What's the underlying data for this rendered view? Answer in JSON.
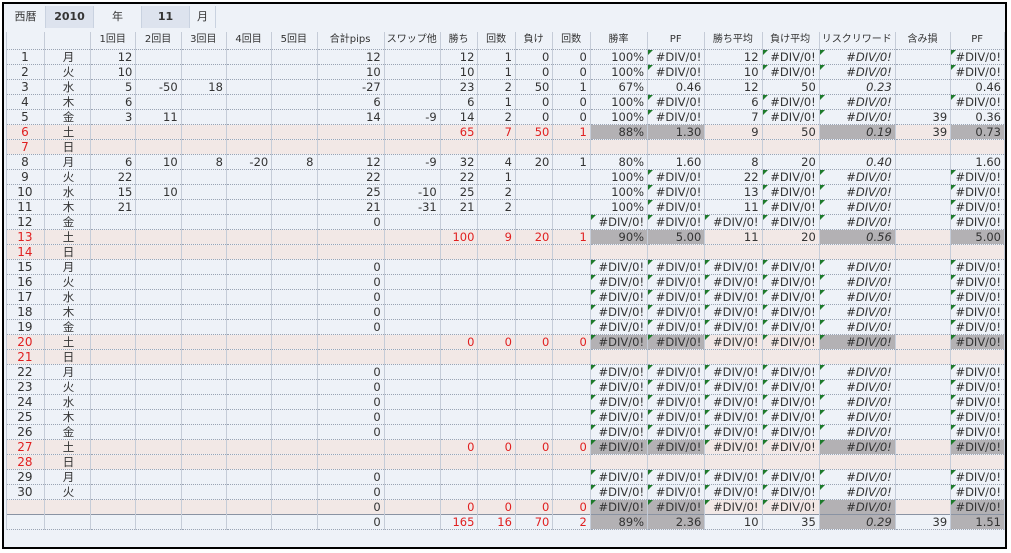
{
  "top": {
    "era_label": "西暦",
    "year_value": "2010",
    "year_label": "年",
    "month_value": "11",
    "month_label": "月"
  },
  "headers": [
    "",
    "",
    "1回目",
    "2回目",
    "3回目",
    "4回目",
    "5回目",
    "合計pips",
    "スワップ他",
    "勝ち",
    "回数",
    "負け",
    "回数",
    "勝率",
    "PF",
    "勝ち平均",
    "負け平均",
    "リスクリワード",
    "含み損",
    "PF"
  ],
  "colors": {
    "weekend_bg": "#f2e8e6",
    "red_text": "#e02020",
    "gray_cell": "#b3b1b4",
    "sheet_bg": "#eef2f8"
  },
  "rows": [
    {
      "t": "d",
      "c": [
        "1",
        "月",
        "12",
        "",
        "",
        "",
        "",
        "12",
        "",
        "12",
        "1",
        "0",
        "0",
        "100%",
        "#DIV/0!",
        "12",
        "#DIV/0!",
        "#DIV/0!",
        "",
        "#DIV/0!"
      ]
    },
    {
      "t": "d",
      "c": [
        "2",
        "火",
        "10",
        "",
        "",
        "",
        "",
        "10",
        "",
        "10",
        "1",
        "0",
        "0",
        "100%",
        "#DIV/0!",
        "10",
        "#DIV/0!",
        "#DIV/0!",
        "",
        "#DIV/0!"
      ]
    },
    {
      "t": "d",
      "c": [
        "3",
        "水",
        "5",
        "-50",
        "18",
        "",
        "",
        "-27",
        "",
        "23",
        "2",
        "50",
        "1",
        "67%",
        "0.46",
        "12",
        "50",
        "0.23",
        "",
        "0.46"
      ]
    },
    {
      "t": "d",
      "c": [
        "4",
        "木",
        "6",
        "",
        "",
        "",
        "",
        "6",
        "",
        "6",
        "1",
        "0",
        "0",
        "100%",
        "#DIV/0!",
        "6",
        "#DIV/0!",
        "#DIV/0!",
        "",
        "#DIV/0!"
      ]
    },
    {
      "t": "d",
      "c": [
        "5",
        "金",
        "3",
        "11",
        "",
        "",
        "",
        "14",
        "-9",
        "14",
        "2",
        "0",
        "0",
        "100%",
        "#DIV/0!",
        "7",
        "#DIV/0!",
        "#DIV/0!",
        "39",
        "0.36"
      ]
    },
    {
      "t": "w",
      "c": [
        "6",
        "土",
        "",
        "",
        "",
        "",
        "",
        "",
        "",
        "65",
        "7",
        "50",
        "1",
        "88%",
        "1.30",
        "9",
        "50",
        "0.19",
        "39",
        "0.73"
      ]
    },
    {
      "t": "s",
      "c": [
        "7",
        "日",
        "",
        "",
        "",
        "",
        "",
        "",
        "",
        "",
        "",
        "",
        "",
        "",
        "",
        "",
        "",
        "",
        "",
        ""
      ]
    },
    {
      "t": "d",
      "c": [
        "8",
        "月",
        "6",
        "10",
        "8",
        "-20",
        "8",
        "12",
        "-9",
        "32",
        "4",
        "20",
        "1",
        "80%",
        "1.60",
        "8",
        "20",
        "0.40",
        "",
        "1.60"
      ]
    },
    {
      "t": "d",
      "c": [
        "9",
        "火",
        "22",
        "",
        "",
        "",
        "",
        "22",
        "",
        "22",
        "1",
        "",
        "",
        "100%",
        "#DIV/0!",
        "22",
        "#DIV/0!",
        "#DIV/0!",
        "",
        "#DIV/0!"
      ]
    },
    {
      "t": "d",
      "c": [
        "10",
        "水",
        "15",
        "10",
        "",
        "",
        "",
        "25",
        "-10",
        "25",
        "2",
        "",
        "",
        "100%",
        "#DIV/0!",
        "13",
        "#DIV/0!",
        "#DIV/0!",
        "",
        "#DIV/0!"
      ]
    },
    {
      "t": "d",
      "c": [
        "11",
        "木",
        "21",
        "",
        "",
        "",
        "",
        "21",
        "-31",
        "21",
        "2",
        "",
        "",
        "100%",
        "#DIV/0!",
        "11",
        "#DIV/0!",
        "#DIV/0!",
        "",
        "#DIV/0!"
      ]
    },
    {
      "t": "d",
      "c": [
        "12",
        "金",
        "",
        "",
        "",
        "",
        "",
        "0",
        "",
        "",
        "",
        "",
        "",
        "#DIV/0!",
        "#DIV/0!",
        "#DIV/0!",
        "#DIV/0!",
        "#DIV/0!",
        "",
        "#DIV/0!"
      ]
    },
    {
      "t": "w",
      "c": [
        "13",
        "土",
        "",
        "",
        "",
        "",
        "",
        "",
        "",
        "100",
        "9",
        "20",
        "1",
        "90%",
        "5.00",
        "11",
        "20",
        "0.56",
        "",
        "5.00"
      ]
    },
    {
      "t": "s",
      "c": [
        "14",
        "日",
        "",
        "",
        "",
        "",
        "",
        "",
        "",
        "",
        "",
        "",
        "",
        "",
        "",
        "",
        "",
        "",
        "",
        ""
      ]
    },
    {
      "t": "d",
      "c": [
        "15",
        "月",
        "",
        "",
        "",
        "",
        "",
        "0",
        "",
        "",
        "",
        "",
        "",
        "#DIV/0!",
        "#DIV/0!",
        "#DIV/0!",
        "#DIV/0!",
        "#DIV/0!",
        "",
        "#DIV/0!"
      ]
    },
    {
      "t": "d",
      "c": [
        "16",
        "火",
        "",
        "",
        "",
        "",
        "",
        "0",
        "",
        "",
        "",
        "",
        "",
        "#DIV/0!",
        "#DIV/0!",
        "#DIV/0!",
        "#DIV/0!",
        "#DIV/0!",
        "",
        "#DIV/0!"
      ]
    },
    {
      "t": "d",
      "c": [
        "17",
        "水",
        "",
        "",
        "",
        "",
        "",
        "0",
        "",
        "",
        "",
        "",
        "",
        "#DIV/0!",
        "#DIV/0!",
        "#DIV/0!",
        "#DIV/0!",
        "#DIV/0!",
        "",
        "#DIV/0!"
      ]
    },
    {
      "t": "d",
      "c": [
        "18",
        "木",
        "",
        "",
        "",
        "",
        "",
        "0",
        "",
        "",
        "",
        "",
        "",
        "#DIV/0!",
        "#DIV/0!",
        "#DIV/0!",
        "#DIV/0!",
        "#DIV/0!",
        "",
        "#DIV/0!"
      ]
    },
    {
      "t": "d",
      "c": [
        "19",
        "金",
        "",
        "",
        "",
        "",
        "",
        "0",
        "",
        "",
        "",
        "",
        "",
        "#DIV/0!",
        "#DIV/0!",
        "#DIV/0!",
        "#DIV/0!",
        "#DIV/0!",
        "",
        "#DIV/0!"
      ]
    },
    {
      "t": "w",
      "c": [
        "20",
        "土",
        "",
        "",
        "",
        "",
        "",
        "",
        "",
        "0",
        "0",
        "0",
        "0",
        "#DIV/0!",
        "#DIV/0!",
        "#DIV/0!",
        "#DIV/0!",
        "#DIV/0!",
        "",
        "#DIV/0!"
      ]
    },
    {
      "t": "s",
      "c": [
        "21",
        "日",
        "",
        "",
        "",
        "",
        "",
        "",
        "",
        "",
        "",
        "",
        "",
        "",
        "",
        "",
        "",
        "",
        "",
        ""
      ]
    },
    {
      "t": "d",
      "c": [
        "22",
        "月",
        "",
        "",
        "",
        "",
        "",
        "0",
        "",
        "",
        "",
        "",
        "",
        "#DIV/0!",
        "#DIV/0!",
        "#DIV/0!",
        "#DIV/0!",
        "#DIV/0!",
        "",
        "#DIV/0!"
      ]
    },
    {
      "t": "d",
      "c": [
        "23",
        "火",
        "",
        "",
        "",
        "",
        "",
        "0",
        "",
        "",
        "",
        "",
        "",
        "#DIV/0!",
        "#DIV/0!",
        "#DIV/0!",
        "#DIV/0!",
        "#DIV/0!",
        "",
        "#DIV/0!"
      ]
    },
    {
      "t": "d",
      "c": [
        "24",
        "水",
        "",
        "",
        "",
        "",
        "",
        "0",
        "",
        "",
        "",
        "",
        "",
        "#DIV/0!",
        "#DIV/0!",
        "#DIV/0!",
        "#DIV/0!",
        "#DIV/0!",
        "",
        "#DIV/0!"
      ]
    },
    {
      "t": "d",
      "c": [
        "25",
        "木",
        "",
        "",
        "",
        "",
        "",
        "0",
        "",
        "",
        "",
        "",
        "",
        "#DIV/0!",
        "#DIV/0!",
        "#DIV/0!",
        "#DIV/0!",
        "#DIV/0!",
        "",
        "#DIV/0!"
      ]
    },
    {
      "t": "d",
      "c": [
        "26",
        "金",
        "",
        "",
        "",
        "",
        "",
        "0",
        "",
        "",
        "",
        "",
        "",
        "#DIV/0!",
        "#DIV/0!",
        "#DIV/0!",
        "#DIV/0!",
        "#DIV/0!",
        "",
        "#DIV/0!"
      ]
    },
    {
      "t": "w",
      "c": [
        "27",
        "土",
        "",
        "",
        "",
        "",
        "",
        "",
        "",
        "0",
        "0",
        "0",
        "0",
        "#DIV/0!",
        "#DIV/0!",
        "#DIV/0!",
        "#DIV/0!",
        "#DIV/0!",
        "",
        "#DIV/0!"
      ]
    },
    {
      "t": "s",
      "c": [
        "28",
        "日",
        "",
        "",
        "",
        "",
        "",
        "",
        "",
        "",
        "",
        "",
        "",
        "",
        "",
        "",
        "",
        "",
        "",
        ""
      ]
    },
    {
      "t": "d",
      "c": [
        "29",
        "月",
        "",
        "",
        "",
        "",
        "",
        "0",
        "",
        "",
        "",
        "",
        "",
        "#DIV/0!",
        "#DIV/0!",
        "#DIV/0!",
        "#DIV/0!",
        "#DIV/0!",
        "",
        "#DIV/0!"
      ]
    },
    {
      "t": "d",
      "c": [
        "30",
        "火",
        "",
        "",
        "",
        "",
        "",
        "0",
        "",
        "",
        "",
        "",
        "",
        "#DIV/0!",
        "#DIV/0!",
        "#DIV/0!",
        "#DIV/0!",
        "#DIV/0!",
        "",
        "#DIV/0!"
      ]
    },
    {
      "t": "w",
      "c": [
        "",
        "",
        "",
        "",
        "",
        "",
        "",
        "0",
        "",
        "0",
        "0",
        "0",
        "0",
        "#DIV/0!",
        "#DIV/0!",
        "#DIV/0!",
        "#DIV/0!",
        "#DIV/0!",
        "",
        "#DIV/0!"
      ]
    },
    {
      "t": "total",
      "c": [
        "",
        "",
        "",
        "",
        "",
        "",
        "",
        "0",
        "",
        "165",
        "16",
        "70",
        "2",
        "89%",
        "2.36",
        "10",
        "35",
        "0.29",
        "39",
        "1.51"
      ]
    }
  ]
}
